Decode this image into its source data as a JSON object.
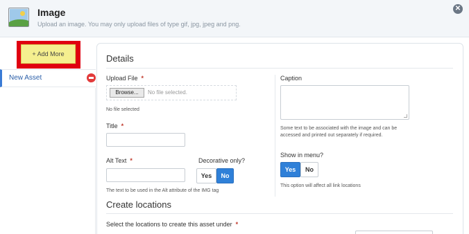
{
  "header": {
    "title": "Image",
    "subtitle": "Upload an image. You may only upload files of type gif, jpg, jpeg and png.",
    "close_glyph": "✕",
    "icon": "image-icon"
  },
  "sidebar": {
    "add_more_label": "+ Add More",
    "items": [
      {
        "label": "New Asset",
        "icon": "remove-icon"
      }
    ]
  },
  "details": {
    "section_title": "Details",
    "upload_file": {
      "label": "Upload File",
      "required": "*",
      "browse_label": "Browse...",
      "file_status": "No file selected.",
      "help": "No file selected"
    },
    "title_field": {
      "label": "Title",
      "required": "*",
      "value": ""
    },
    "alt_text": {
      "label": "Alt Text",
      "required": "*",
      "value": "",
      "help": "The text to be used in the Alt attribute of the IMG tag"
    },
    "decorative": {
      "label": "Decorative only?",
      "yes": "Yes",
      "no": "No",
      "selected": "No"
    },
    "caption": {
      "label": "Caption",
      "value": "",
      "help": "Some text to be associated with the image and can be accessed and printed out separately if required."
    },
    "show_in_menu": {
      "label": "Show in menu?",
      "yes": "Yes",
      "no": "No",
      "selected": "Yes",
      "help": "This option will affect all link locations"
    }
  },
  "locations": {
    "section_title": "Create locations",
    "select_label": "Select the locations to create this asset under",
    "required": "*"
  },
  "colors": {
    "accent": "#2f80d8",
    "highlight": "#e00010",
    "add_more_bg": "#f5ef8f",
    "remove": "#e23a3a",
    "required": "#c0392b"
  }
}
